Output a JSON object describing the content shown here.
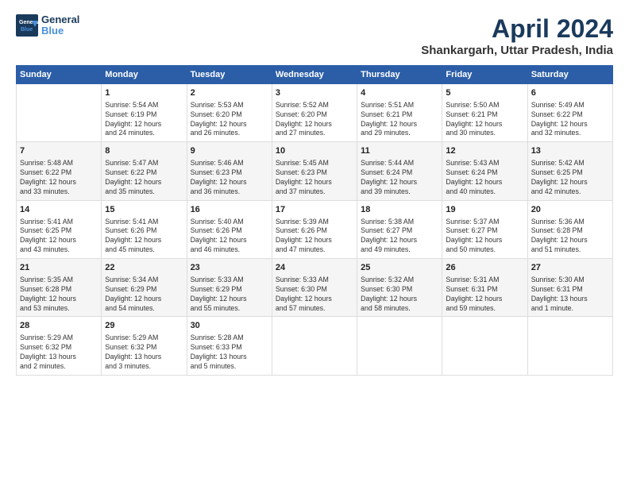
{
  "logo": {
    "line1": "General",
    "line2": "Blue"
  },
  "title": "April 2024",
  "subtitle": "Shankargarh, Uttar Pradesh, India",
  "headers": [
    "Sunday",
    "Monday",
    "Tuesday",
    "Wednesday",
    "Thursday",
    "Friday",
    "Saturday"
  ],
  "weeks": [
    [
      {
        "day": "",
        "info": ""
      },
      {
        "day": "1",
        "info": "Sunrise: 5:54 AM\nSunset: 6:19 PM\nDaylight: 12 hours\nand 24 minutes."
      },
      {
        "day": "2",
        "info": "Sunrise: 5:53 AM\nSunset: 6:20 PM\nDaylight: 12 hours\nand 26 minutes."
      },
      {
        "day": "3",
        "info": "Sunrise: 5:52 AM\nSunset: 6:20 PM\nDaylight: 12 hours\nand 27 minutes."
      },
      {
        "day": "4",
        "info": "Sunrise: 5:51 AM\nSunset: 6:21 PM\nDaylight: 12 hours\nand 29 minutes."
      },
      {
        "day": "5",
        "info": "Sunrise: 5:50 AM\nSunset: 6:21 PM\nDaylight: 12 hours\nand 30 minutes."
      },
      {
        "day": "6",
        "info": "Sunrise: 5:49 AM\nSunset: 6:22 PM\nDaylight: 12 hours\nand 32 minutes."
      }
    ],
    [
      {
        "day": "7",
        "info": "Sunrise: 5:48 AM\nSunset: 6:22 PM\nDaylight: 12 hours\nand 33 minutes."
      },
      {
        "day": "8",
        "info": "Sunrise: 5:47 AM\nSunset: 6:22 PM\nDaylight: 12 hours\nand 35 minutes."
      },
      {
        "day": "9",
        "info": "Sunrise: 5:46 AM\nSunset: 6:23 PM\nDaylight: 12 hours\nand 36 minutes."
      },
      {
        "day": "10",
        "info": "Sunrise: 5:45 AM\nSunset: 6:23 PM\nDaylight: 12 hours\nand 37 minutes."
      },
      {
        "day": "11",
        "info": "Sunrise: 5:44 AM\nSunset: 6:24 PM\nDaylight: 12 hours\nand 39 minutes."
      },
      {
        "day": "12",
        "info": "Sunrise: 5:43 AM\nSunset: 6:24 PM\nDaylight: 12 hours\nand 40 minutes."
      },
      {
        "day": "13",
        "info": "Sunrise: 5:42 AM\nSunset: 6:25 PM\nDaylight: 12 hours\nand 42 minutes."
      }
    ],
    [
      {
        "day": "14",
        "info": "Sunrise: 5:41 AM\nSunset: 6:25 PM\nDaylight: 12 hours\nand 43 minutes."
      },
      {
        "day": "15",
        "info": "Sunrise: 5:41 AM\nSunset: 6:26 PM\nDaylight: 12 hours\nand 45 minutes."
      },
      {
        "day": "16",
        "info": "Sunrise: 5:40 AM\nSunset: 6:26 PM\nDaylight: 12 hours\nand 46 minutes."
      },
      {
        "day": "17",
        "info": "Sunrise: 5:39 AM\nSunset: 6:26 PM\nDaylight: 12 hours\nand 47 minutes."
      },
      {
        "day": "18",
        "info": "Sunrise: 5:38 AM\nSunset: 6:27 PM\nDaylight: 12 hours\nand 49 minutes."
      },
      {
        "day": "19",
        "info": "Sunrise: 5:37 AM\nSunset: 6:27 PM\nDaylight: 12 hours\nand 50 minutes."
      },
      {
        "day": "20",
        "info": "Sunrise: 5:36 AM\nSunset: 6:28 PM\nDaylight: 12 hours\nand 51 minutes."
      }
    ],
    [
      {
        "day": "21",
        "info": "Sunrise: 5:35 AM\nSunset: 6:28 PM\nDaylight: 12 hours\nand 53 minutes."
      },
      {
        "day": "22",
        "info": "Sunrise: 5:34 AM\nSunset: 6:29 PM\nDaylight: 12 hours\nand 54 minutes."
      },
      {
        "day": "23",
        "info": "Sunrise: 5:33 AM\nSunset: 6:29 PM\nDaylight: 12 hours\nand 55 minutes."
      },
      {
        "day": "24",
        "info": "Sunrise: 5:33 AM\nSunset: 6:30 PM\nDaylight: 12 hours\nand 57 minutes."
      },
      {
        "day": "25",
        "info": "Sunrise: 5:32 AM\nSunset: 6:30 PM\nDaylight: 12 hours\nand 58 minutes."
      },
      {
        "day": "26",
        "info": "Sunrise: 5:31 AM\nSunset: 6:31 PM\nDaylight: 12 hours\nand 59 minutes."
      },
      {
        "day": "27",
        "info": "Sunrise: 5:30 AM\nSunset: 6:31 PM\nDaylight: 13 hours\nand 1 minute."
      }
    ],
    [
      {
        "day": "28",
        "info": "Sunrise: 5:29 AM\nSunset: 6:32 PM\nDaylight: 13 hours\nand 2 minutes."
      },
      {
        "day": "29",
        "info": "Sunrise: 5:29 AM\nSunset: 6:32 PM\nDaylight: 13 hours\nand 3 minutes."
      },
      {
        "day": "30",
        "info": "Sunrise: 5:28 AM\nSunset: 6:33 PM\nDaylight: 13 hours\nand 5 minutes."
      },
      {
        "day": "",
        "info": ""
      },
      {
        "day": "",
        "info": ""
      },
      {
        "day": "",
        "info": ""
      },
      {
        "day": "",
        "info": ""
      }
    ]
  ]
}
